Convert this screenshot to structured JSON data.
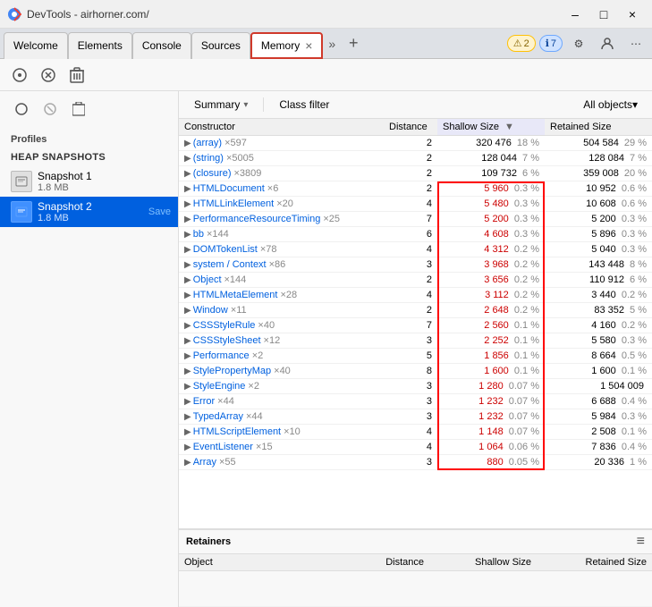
{
  "titlebar": {
    "title": "DevTools - airhorner.com/",
    "min_label": "–",
    "max_label": "□",
    "close_label": "×"
  },
  "tabs": [
    {
      "id": "welcome",
      "label": "Welcome",
      "active": false
    },
    {
      "id": "elements",
      "label": "Elements",
      "active": false
    },
    {
      "id": "console",
      "label": "Console",
      "active": false
    },
    {
      "id": "sources",
      "label": "Sources",
      "active": false
    },
    {
      "id": "memory",
      "label": "Memory",
      "active": true
    }
  ],
  "devtools_toolbar": {
    "badges": {
      "warning": "2",
      "info": "7"
    },
    "icons": [
      "inspect",
      "device",
      "more"
    ]
  },
  "sidebar": {
    "section_label": "Profiles",
    "subsection_label": "HEAP SNAPSHOTS",
    "snapshots": [
      {
        "id": 1,
        "name": "Snapshot 1",
        "size": "1.8 MB",
        "selected": false
      },
      {
        "id": 2,
        "name": "Snapshot 2",
        "size": "1.8 MB",
        "selected": true,
        "save_label": "Save"
      }
    ],
    "bottom_icons": [
      "record",
      "stop",
      "trash"
    ]
  },
  "content_toolbar": {
    "view_options": [
      "Summary",
      "Class filter"
    ],
    "filter_dropdown": "All objects",
    "summary_label": "Summary",
    "class_filter_label": "Class filter",
    "all_objects_label": "All objects"
  },
  "table": {
    "columns": [
      {
        "id": "constructor",
        "label": "Constructor"
      },
      {
        "id": "distance",
        "label": "Distance"
      },
      {
        "id": "shallow",
        "label": "Shallow Size"
      },
      {
        "id": "retained",
        "label": "Retained Size"
      }
    ],
    "rows": [
      {
        "constructor": "(array)",
        "count": "×597",
        "distance": "2",
        "shallow": "320 476",
        "shallow_pct": "18 %",
        "retained": "504 584",
        "retained_pct": "29 %"
      },
      {
        "constructor": "(string)",
        "count": "×5005",
        "distance": "2",
        "shallow": "128 044",
        "shallow_pct": "7 %",
        "retained": "128 084",
        "retained_pct": "7 %"
      },
      {
        "constructor": "(closure)",
        "count": "×3809",
        "distance": "2",
        "shallow": "109 732",
        "shallow_pct": "6 %",
        "retained": "359 008",
        "retained_pct": "20 %"
      },
      {
        "constructor": "HTMLDocument",
        "count": "×6",
        "distance": "2",
        "shallow": "5 960",
        "shallow_pct": "0.3 %",
        "retained": "10 952",
        "retained_pct": "0.6 %",
        "highlight": true
      },
      {
        "constructor": "HTMLLinkElement",
        "count": "×20",
        "distance": "4",
        "shallow": "5 480",
        "shallow_pct": "0.3 %",
        "retained": "10 608",
        "retained_pct": "0.6 %",
        "highlight": true
      },
      {
        "constructor": "PerformanceResourceTiming",
        "count": "×25",
        "distance": "7",
        "shallow": "5 200",
        "shallow_pct": "0.3 %",
        "retained": "5 200",
        "retained_pct": "0.3 %",
        "highlight": true
      },
      {
        "constructor": "bb",
        "count": "×144",
        "distance": "6",
        "shallow": "4 608",
        "shallow_pct": "0.3 %",
        "retained": "5 896",
        "retained_pct": "0.3 %",
        "highlight": true
      },
      {
        "constructor": "DOMTokenList",
        "count": "×78",
        "distance": "4",
        "shallow": "4 312",
        "shallow_pct": "0.2 %",
        "retained": "5 040",
        "retained_pct": "0.3 %",
        "highlight": true
      },
      {
        "constructor": "system / Context",
        "count": "×86",
        "distance": "3",
        "shallow": "3 968",
        "shallow_pct": "0.2 %",
        "retained": "143 448",
        "retained_pct": "8 %",
        "highlight": true
      },
      {
        "constructor": "Object",
        "count": "×144",
        "distance": "2",
        "shallow": "3 656",
        "shallow_pct": "0.2 %",
        "retained": "110 912",
        "retained_pct": "6 %",
        "highlight": true
      },
      {
        "constructor": "HTMLMetaElement",
        "count": "×28",
        "distance": "4",
        "shallow": "3 112",
        "shallow_pct": "0.2 %",
        "retained": "3 440",
        "retained_pct": "0.2 %",
        "highlight": true
      },
      {
        "constructor": "Window",
        "count": "×11",
        "distance": "2",
        "shallow": "2 648",
        "shallow_pct": "0.2 %",
        "retained": "83 352",
        "retained_pct": "5 %",
        "highlight": true
      },
      {
        "constructor": "CSSStyleRule",
        "count": "×40",
        "distance": "7",
        "shallow": "2 560",
        "shallow_pct": "0.1 %",
        "retained": "4 160",
        "retained_pct": "0.2 %",
        "highlight": true
      },
      {
        "constructor": "CSSStyleSheet",
        "count": "×12",
        "distance": "3",
        "shallow": "2 252",
        "shallow_pct": "0.1 %",
        "retained": "5 580",
        "retained_pct": "0.3 %",
        "highlight": true
      },
      {
        "constructor": "Performance",
        "count": "×2",
        "distance": "5",
        "shallow": "1 856",
        "shallow_pct": "0.1 %",
        "retained": "8 664",
        "retained_pct": "0.5 %",
        "highlight": true
      },
      {
        "constructor": "StylePropertyMap",
        "count": "×40",
        "distance": "8",
        "shallow": "1 600",
        "shallow_pct": "0.1 %",
        "retained": "1 600",
        "retained_pct": "0.1 %",
        "highlight": true
      },
      {
        "constructor": "StyleEngine",
        "count": "×2",
        "distance": "3",
        "shallow": "1 280",
        "shallow_pct": "0.07 %",
        "retained": "1 504 009",
        "retained_pct": "",
        "highlight": true
      },
      {
        "constructor": "Error",
        "count": "×44",
        "distance": "3",
        "shallow": "1 232",
        "shallow_pct": "0.07 %",
        "retained": "6 688",
        "retained_pct": "0.4 %",
        "highlight": true
      },
      {
        "constructor": "TypedArray",
        "count": "×44",
        "distance": "3",
        "shallow": "1 232",
        "shallow_pct": "0.07 %",
        "retained": "5 984",
        "retained_pct": "0.3 %",
        "highlight": true
      },
      {
        "constructor": "HTMLScriptElement",
        "count": "×10",
        "distance": "4",
        "shallow": "1 148",
        "shallow_pct": "0.07 %",
        "retained": "2 508",
        "retained_pct": "0.1 %",
        "highlight": true
      },
      {
        "constructor": "EventListener",
        "count": "×15",
        "distance": "4",
        "shallow": "1 064",
        "shallow_pct": "0.06 %",
        "retained": "7 836",
        "retained_pct": "0.4 %",
        "highlight": true
      },
      {
        "constructor": "Array",
        "count": "×55",
        "distance": "3",
        "shallow": "880",
        "shallow_pct": "0.05 %",
        "retained": "20 336",
        "retained_pct": "1 %",
        "highlight": true
      }
    ]
  },
  "retainers": {
    "title": "Retainers",
    "columns": [
      {
        "id": "object",
        "label": "Object"
      },
      {
        "id": "distance",
        "label": "Distance"
      },
      {
        "id": "shallow",
        "label": "Shallow Size"
      },
      {
        "id": "retained",
        "label": "Retained Size"
      }
    ]
  }
}
